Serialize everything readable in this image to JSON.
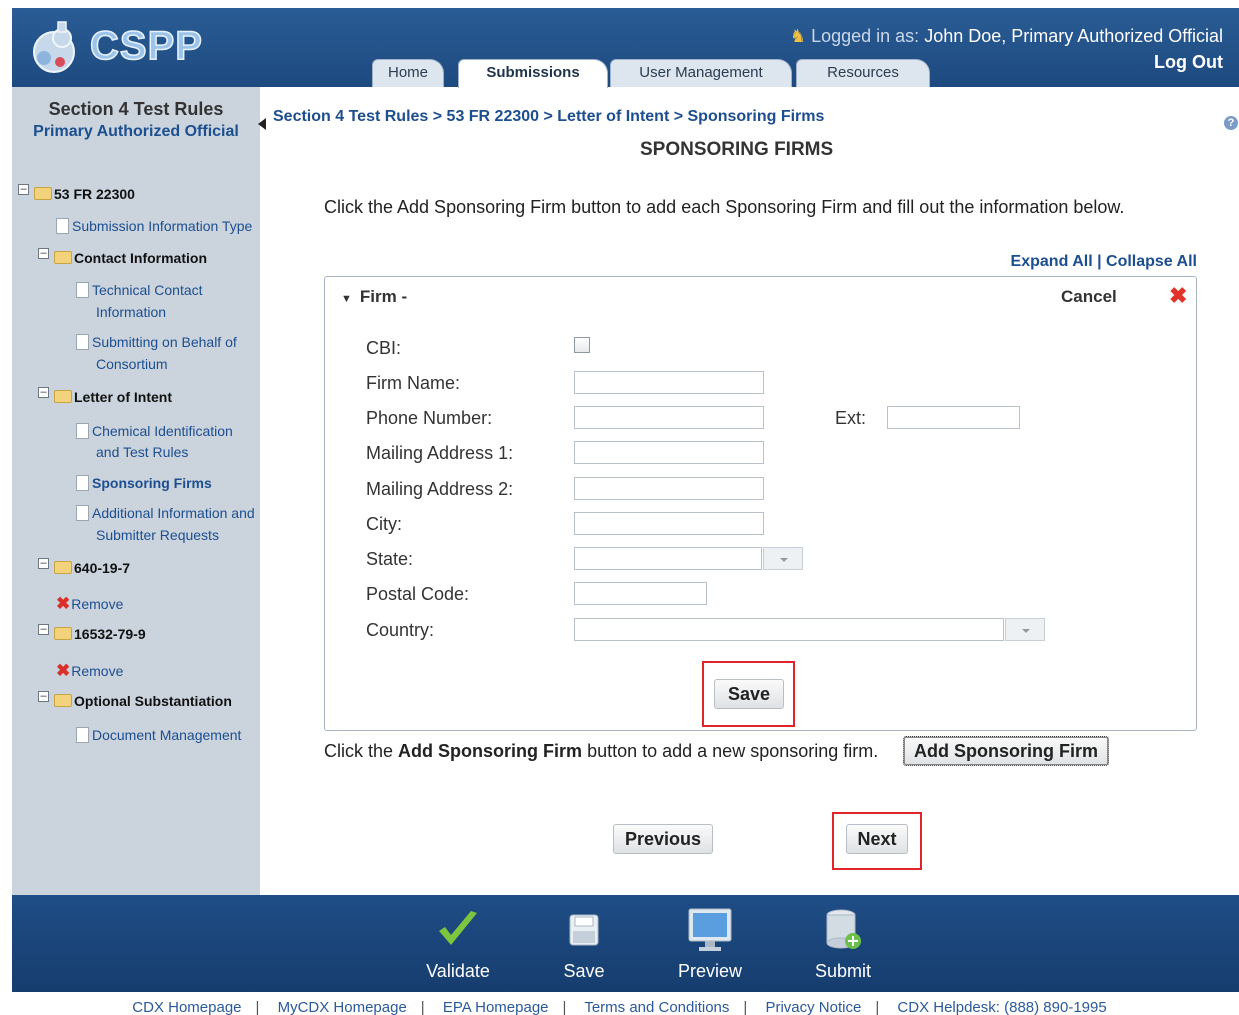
{
  "header": {
    "logo_text": "CSPP",
    "logged_in_prefix": "Logged in as:",
    "logged_in_user": "John Doe, Primary Authorized Official",
    "logout": "Log Out",
    "tabs": [
      "Home",
      "Submissions",
      "User Management",
      "Resources"
    ],
    "active_tab": "Submissions"
  },
  "sidebar": {
    "title": "Section 4 Test Rules",
    "subtitle": "Primary Authorized Official",
    "tree": {
      "root": "53 FR 22300",
      "submission_info": "Submission Information Type",
      "contact_info": "Contact Information",
      "technical_contact": [
        "Technical Contact",
        "Information"
      ],
      "submitting_behalf": [
        "Submitting on Behalf of",
        "Consortium"
      ],
      "letter_of_intent": "Letter of Intent",
      "chemical_id": [
        "Chemical Identification",
        "and Test Rules"
      ],
      "sponsoring_firms": "Sponsoring Firms",
      "additional_info": [
        "Additional Information and",
        "Submitter Requests"
      ],
      "chem1": "640-19-7",
      "chem2": "16532-79-9",
      "remove": "Remove",
      "optional": "Optional Substantiation",
      "doc_mgmt": "Document Management"
    }
  },
  "main": {
    "breadcrumb": "Section 4 Test Rules > 53 FR 22300 > Letter of Intent > Sponsoring Firms",
    "title": "SPONSORING FIRMS",
    "instructions": "Click the Add Sponsoring Firm button to add each Sponsoring Firm and fill out the information below.",
    "expand_all": "Expand All",
    "collapse_all": "Collapse All",
    "firm_header": "Firm -",
    "cancel": "Cancel",
    "fields": {
      "cbi": "CBI:",
      "firm_name": "Firm Name:",
      "phone": "Phone Number:",
      "ext": "Ext:",
      "mail1": "Mailing Address 1:",
      "mail2": "Mailing Address 2:",
      "city": "City:",
      "state": "State:",
      "postal": "Postal Code:",
      "country": "Country:"
    },
    "save": "Save",
    "add_prefix": "Click the",
    "add_bold": "Add Sponsoring Firm",
    "add_suffix": "button to add a new sponsoring firm.",
    "add_button": "Add Sponsoring Firm",
    "previous": "Previous",
    "next": "Next"
  },
  "toolbar": {
    "validate": "Validate",
    "save": "Save",
    "preview": "Preview",
    "submit": "Submit"
  },
  "footer": {
    "links": [
      "CDX Homepage",
      "MyCDX Homepage",
      "EPA Homepage",
      "Terms and Conditions",
      "Privacy Notice",
      "CDX Helpdesk: (888) 890-1995"
    ]
  }
}
